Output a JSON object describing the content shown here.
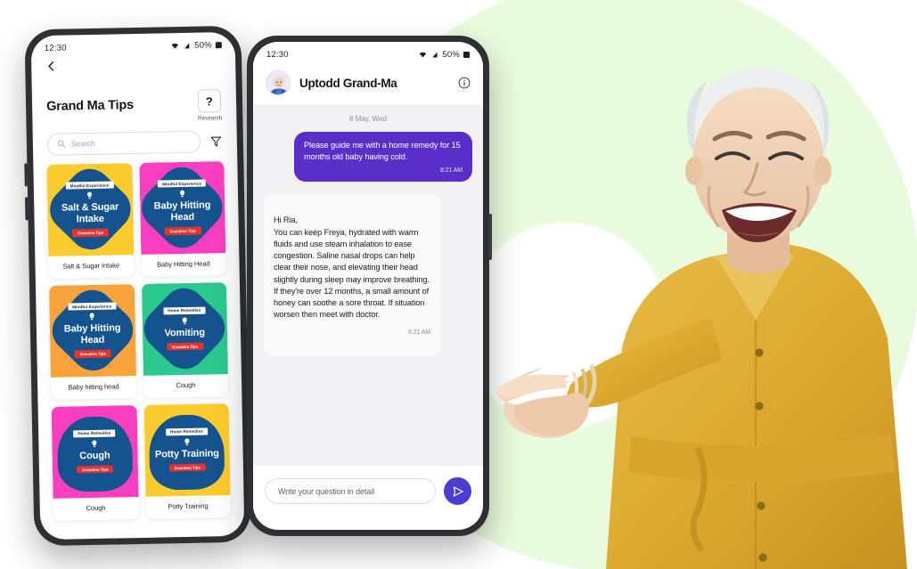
{
  "background": {
    "circle_color": "#e9fbdd",
    "page_color": "#ffffff"
  },
  "left_phone": {
    "status": {
      "time": "12:30",
      "battery": "50%",
      "icons": [
        "wifi-icon",
        "signal-icon",
        "battery-icon"
      ]
    },
    "back_icon": "chevron-left-icon",
    "title": "Grand Ma Tips",
    "research": {
      "glyph": "?",
      "label": "Research"
    },
    "search": {
      "placeholder": "Search",
      "icon": "search-icon"
    },
    "filter_icon": "filter-icon",
    "cards": [
      {
        "label": "Salt & Sugar Intake",
        "art_title": "Salt & Sugar Intake",
        "banner": "Mindful Experience",
        "badge": "Grandma Tips",
        "bg": "#fccc2e",
        "shape": "diamond"
      },
      {
        "label": "Baby Hitting Head",
        "art_title": "Baby Hitting Head",
        "banner": "Mindful Experience",
        "badge": "Grandma Tips",
        "bg": "#fa3ec0",
        "shape": "diamond"
      },
      {
        "label": "Baby hitting head",
        "art_title": "Baby Hitting Head",
        "banner": "Mindful Experience",
        "badge": "Grandma Tips",
        "bg": "#f9a33c",
        "shape": "diamond"
      },
      {
        "label": "Cough",
        "art_title": "Vomiting",
        "banner": "Home Remedies",
        "badge": "Grandma Tips",
        "bg": "#2bc98e",
        "shape": "diamond"
      },
      {
        "label": "Cough",
        "art_title": "Cough",
        "banner": "Home Remedies",
        "badge": "Grandma Tips",
        "bg": "#fa3ec0",
        "shape": "blob"
      },
      {
        "label": "Potty Training",
        "art_title": "Potty Training",
        "banner": "Home Remedies",
        "badge": "Grandma Tips",
        "bg": "#fccc2e",
        "shape": "blob"
      }
    ]
  },
  "right_phone": {
    "status": {
      "time": "12:30",
      "battery": "50%",
      "icons": [
        "wifi-icon",
        "signal-icon",
        "battery-icon"
      ]
    },
    "header": {
      "name": "Uptodd Grand-Ma",
      "avatar": "grandma-avatar",
      "info_icon": "info-icon"
    },
    "date_divider": "8 May, Wed",
    "messages": [
      {
        "from": "user",
        "text": "Please guide me with a home remedy for 15 months old baby having cold.",
        "time": "8:21 AM",
        "bubble_color": "#5a2ec9"
      },
      {
        "from": "grandma",
        "text": "Hi Ria,\nYou can keep Freya, hydrated with warm fluids and use steam inhalation to ease congestion. Saline nasal drops can help clear their nose, and elevating their head slightly during sleep may improve breathing. If they're over 12 months, a small amount of honey can soothe a sore throat. If situation worsen then meet with doctor.",
        "time": "8:21 AM",
        "bubble_color": "#fafafa"
      }
    ],
    "input": {
      "placeholder": "Write your question in detail",
      "send_icon": "send-icon",
      "send_color": "#4a3ed0"
    }
  },
  "photo": {
    "subject": "smiling-elderly-woman-pointing",
    "coat_color": "#e0b032",
    "hair_color": "#eceef0"
  }
}
